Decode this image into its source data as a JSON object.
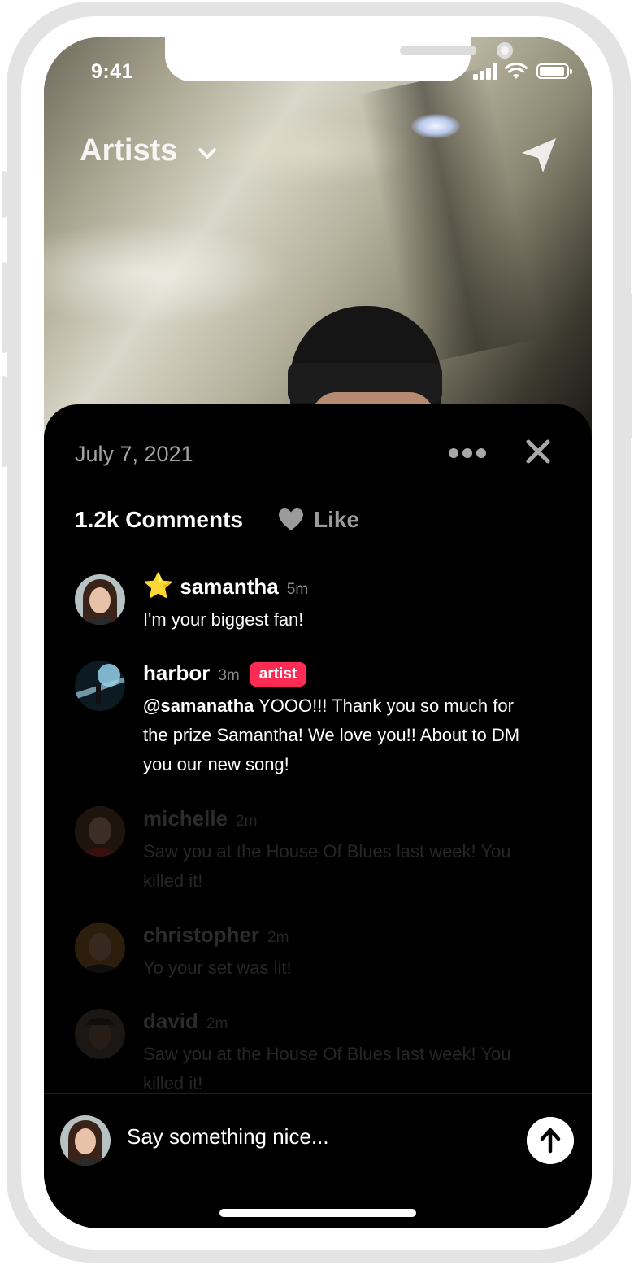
{
  "status_bar": {
    "time": "9:41"
  },
  "header": {
    "title": "Artists",
    "chevron_icon": "chevron-down-icon",
    "action_icon": "send-plane-icon"
  },
  "sheet": {
    "date": "July 7, 2021",
    "more_icon": "more-dots-icon",
    "close_icon": "close-icon",
    "comments_count": "1.2k Comments",
    "like_label": "Like",
    "like_icon": "heart-icon"
  },
  "comments": [
    {
      "name": "samantha",
      "time": "5m",
      "star": "⭐",
      "text": "I'm your biggest fan!"
    },
    {
      "name": "harbor",
      "time": "3m",
      "badge": "artist",
      "mention": "@samanatha",
      "text": " YOOO!!! Thank you so much for the prize Samantha! We love you!! About to DM you our new song!"
    },
    {
      "name": "michelle",
      "time": "2m",
      "text": "Saw you at the House Of Blues last week! You killed it!"
    },
    {
      "name": "christopher",
      "time": "2m",
      "text": "Yo your set was lit!"
    },
    {
      "name": "david",
      "time": "2m",
      "text": "Saw you at the House Of Blues last week! You killed it!"
    }
  ],
  "composer": {
    "placeholder": "Say something nice...",
    "send_icon": "arrow-up-icon"
  },
  "colors": {
    "accent": "#fe2c55",
    "sheet_bg": "#000000",
    "muted_text": "#a3a3a3"
  }
}
